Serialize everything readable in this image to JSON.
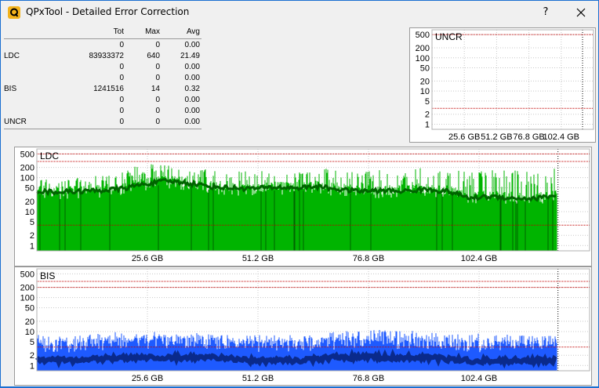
{
  "window": {
    "title": "QPxTool - Detailed Error Correction",
    "help_label": "?",
    "app_icon": "qpxtool-q-icon",
    "close_icon": "close-icon"
  },
  "stats": {
    "headers": [
      "",
      "Tot",
      "Max",
      "Avg"
    ],
    "rows": [
      [
        "",
        "0",
        "0",
        "0.00"
      ],
      [
        "LDC",
        "83933372",
        "640",
        "21.49"
      ],
      [
        "",
        "0",
        "0",
        "0.00"
      ],
      [
        "",
        "0",
        "0",
        "0.00"
      ],
      [
        "BIS",
        "1241516",
        "14",
        "0.32"
      ],
      [
        "",
        "0",
        "0",
        "0.00"
      ],
      [
        "",
        "0",
        "0",
        "0.00"
      ],
      [
        "UNCR",
        "0",
        "0",
        "0.00"
      ]
    ]
  },
  "colors": {
    "ldc_main": "#00b400",
    "ldc_dark": "#006400",
    "bis_main": "#1e5aff",
    "bis_dark": "#0a2a8c",
    "limit_line": "#c00000"
  },
  "chart_data": [
    {
      "type": "area",
      "title": "UNCR",
      "y_scale": "log",
      "y_ticks": [
        "500",
        "200",
        "100",
        "50",
        "20",
        "10",
        "5",
        "2",
        "1"
      ],
      "x_ticks": [
        "25.6 GB",
        "51.2 GB",
        "76.8 GB",
        "102.4 GB"
      ],
      "series": [
        {
          "values": [
            0,
            0,
            0,
            0,
            0
          ]
        }
      ]
    },
    {
      "type": "area",
      "title": "LDC",
      "y_scale": "log",
      "y_ticks": [
        "500",
        "200",
        "100",
        "50",
        "20",
        "10",
        "5",
        "2",
        "1"
      ],
      "x_ticks": [
        "25.6 GB",
        "51.2 GB",
        "76.8 GB",
        "102.4 GB"
      ],
      "x": [
        0,
        5,
        10,
        15,
        20,
        25,
        30,
        35,
        40,
        45,
        50,
        55,
        60,
        65,
        70,
        75,
        80,
        85,
        90,
        95,
        100,
        105,
        110,
        115,
        120
      ],
      "series": [
        {
          "values": [
            40,
            38,
            40,
            42,
            48,
            65,
            80,
            70,
            55,
            50,
            48,
            52,
            50,
            55,
            45,
            40,
            42,
            40,
            45,
            40,
            25,
            28,
            25,
            24,
            30
          ]
        },
        {
          "values": [
            90,
            85,
            100,
            120,
            180,
            260,
            240,
            210,
            180,
            160,
            150,
            170,
            160,
            200,
            160,
            150,
            170,
            160,
            200,
            180,
            150,
            170,
            160,
            170,
            200
          ]
        }
      ]
    },
    {
      "type": "area",
      "title": "BIS",
      "y_scale": "log",
      "y_ticks": [
        "500",
        "200",
        "100",
        "50",
        "20",
        "10",
        "5",
        "2",
        "1"
      ],
      "x_ticks": [
        "25.6 GB",
        "51.2 GB",
        "76.8 GB",
        "102.4 GB"
      ],
      "x": [
        0,
        10,
        20,
        30,
        40,
        50,
        60,
        70,
        80,
        90,
        100,
        110,
        120
      ],
      "series": [
        {
          "values": [
            4,
            4,
            5,
            5,
            5,
            4,
            4,
            5,
            5,
            5,
            4,
            4,
            4
          ]
        },
        {
          "values": [
            8,
            8,
            10,
            10,
            9,
            8,
            8,
            10,
            12,
            10,
            9,
            8,
            8
          ]
        }
      ]
    }
  ]
}
